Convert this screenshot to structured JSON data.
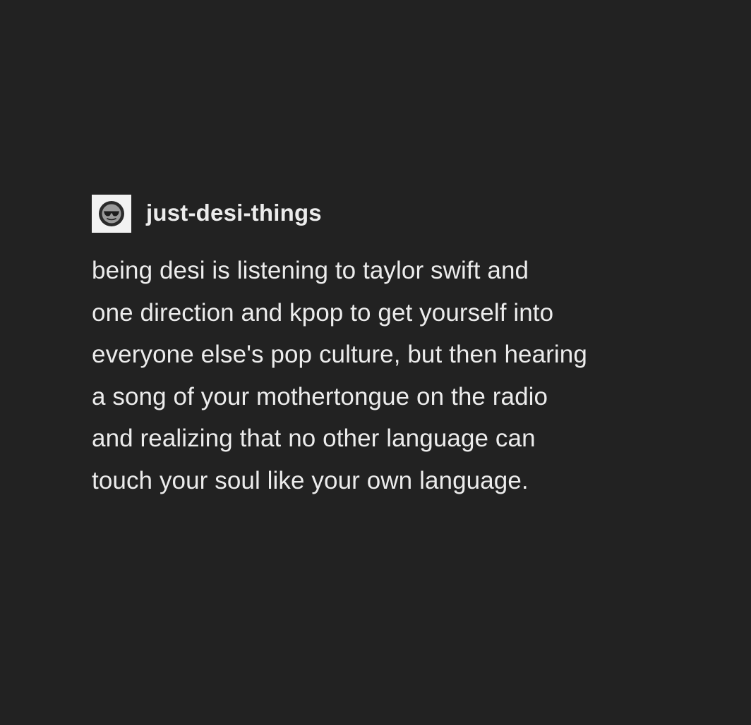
{
  "post": {
    "username": "just-desi-things",
    "avatar_icon": "sunglasses-face-icon",
    "body_lines": [
      "being desi is listening to taylor swift and",
      "one direction and kpop to get yourself into",
      "everyone else's pop culture, but then hearing",
      "a song of your mothertongue on the radio",
      "and realizing that no other language can",
      "touch your soul like your own language."
    ]
  },
  "colors": {
    "background": "#222222",
    "text": "#ececec",
    "avatar_bg": "#f2f2f2"
  }
}
